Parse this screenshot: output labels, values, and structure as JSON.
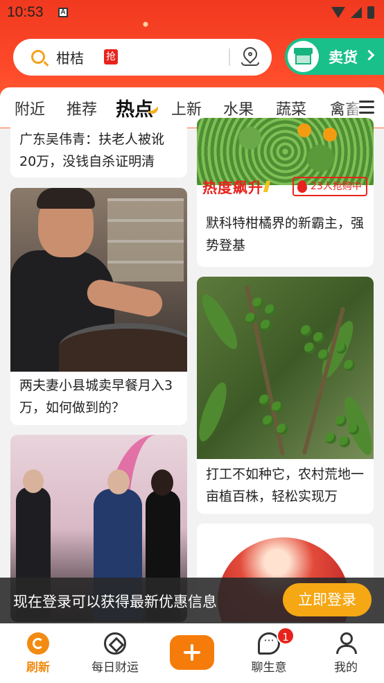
{
  "status_bar": {
    "time": "10:53",
    "notify_icon": "A"
  },
  "search": {
    "value": "柑桔",
    "tag": "抢"
  },
  "sell_button": {
    "label": "卖货"
  },
  "tabs": [
    {
      "label": "附近"
    },
    {
      "label": "推荐"
    },
    {
      "label": "热点"
    },
    {
      "label": "上新"
    },
    {
      "label": "水果"
    },
    {
      "label": "蔬菜"
    },
    {
      "label": "禽畜"
    }
  ],
  "feed": {
    "left": [
      {
        "title": "广东吴伟青：扶老人被讹20万，没钱自杀证明清"
      },
      {
        "title": "两夫妻小县城卖早餐月入3万，如何做到的？"
      },
      {
        "title": ""
      }
    ],
    "right": [
      {
        "hot_label": "热度飙升",
        "buyers": "23人抢购中",
        "title": "默科特柑橘界的新霸主，强势登基"
      },
      {
        "title": "打工不如种它，农村荒地一亩植百株，轻松实现万"
      },
      {
        "title": ""
      }
    ]
  },
  "login_banner": {
    "text": "现在登录可以获得最新优惠信息",
    "button": "立即登录"
  },
  "bottom_nav": [
    {
      "label": "刷新",
      "icon": "refresh-icon"
    },
    {
      "label": "每日财运",
      "icon": "fortune-icon"
    },
    {
      "label": "",
      "icon": "plus-icon"
    },
    {
      "label": "聊生意",
      "icon": "chat-icon",
      "badge": "1"
    },
    {
      "label": "我的",
      "icon": "user-icon"
    }
  ],
  "colors": {
    "brand_orange": "#f28b12",
    "header_red": "#f0391f",
    "sell_green": "#19c089",
    "hot_red": "#e8231d"
  }
}
